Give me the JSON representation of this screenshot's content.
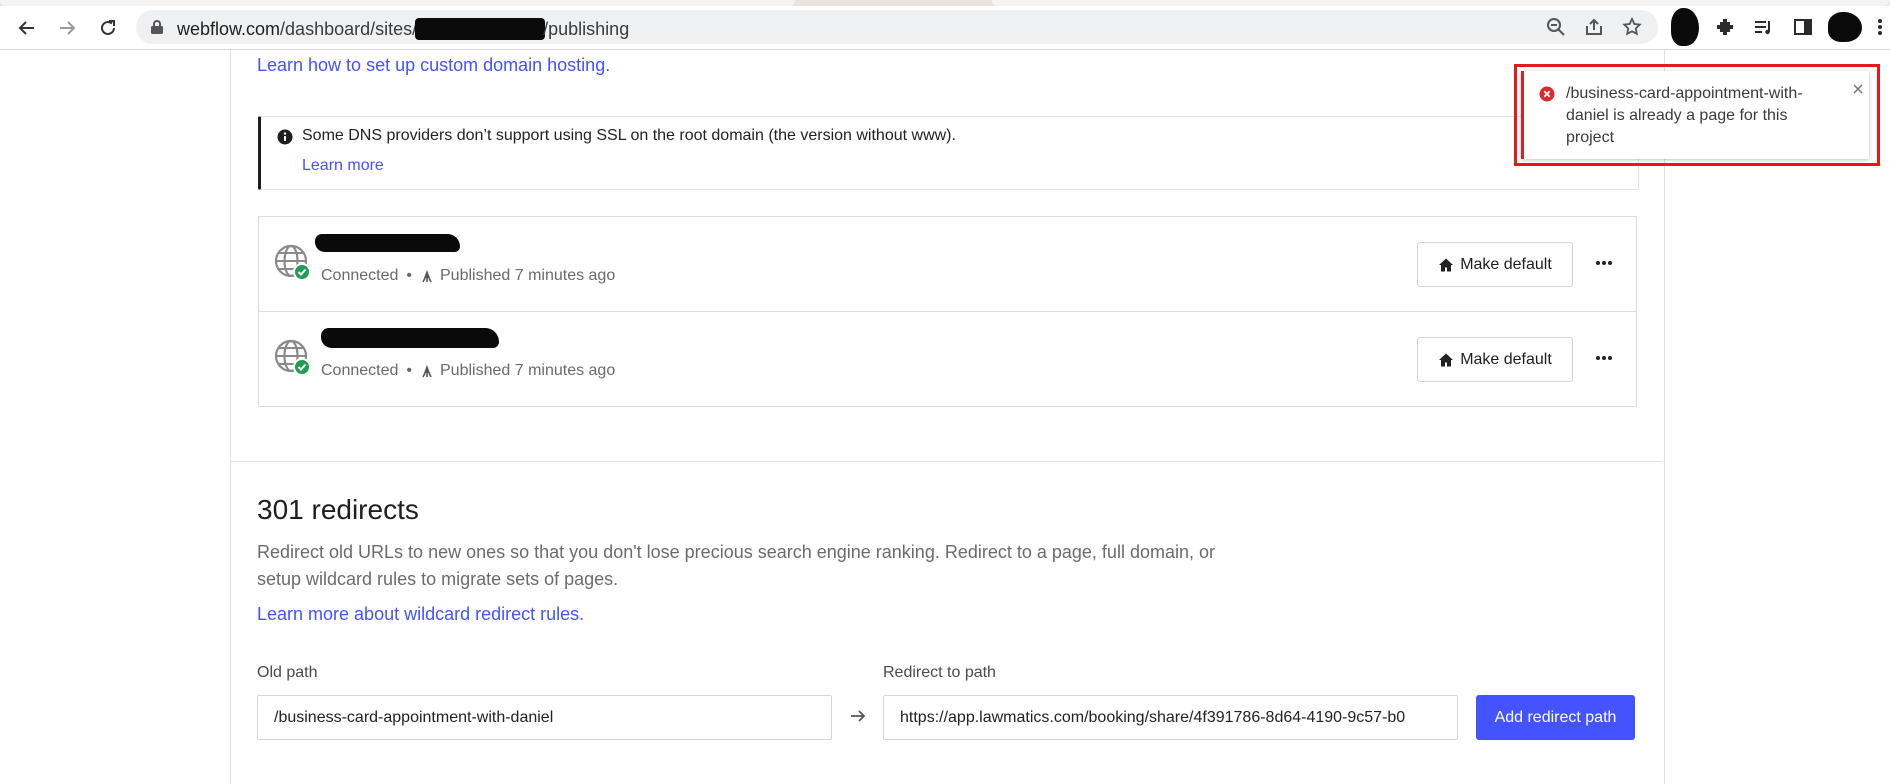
{
  "browser": {
    "url_host": "webflow.com",
    "url_path_prefix": "/dashboard/sites/",
    "url_path_suffix": "/publishing"
  },
  "setup": {
    "learn_link": "Learn how to set up custom domain hosting."
  },
  "info": {
    "text": "Some DNS providers don’t support using SSL on the root domain (the version without www).",
    "learn_more": "Learn more"
  },
  "domains": [
    {
      "status": "Connected",
      "separator": "•",
      "published": "Published 7 minutes ago",
      "action_label": "Make default"
    },
    {
      "status": "Connected",
      "separator": "•",
      "published": "Published 7 minutes ago",
      "action_label": "Make default"
    }
  ],
  "redirects": {
    "title": "301 redirects",
    "description": "Redirect old URLs to new ones so that you don't lose precious search engine ranking. Redirect to a page, full domain, or setup wildcard rules to migrate sets of pages.",
    "learn_link": "Learn more about wildcard redirect rules.",
    "old_path_label": "Old path",
    "old_path_value": "/business-card-appointment-with-daniel",
    "redirect_label": "Redirect to path",
    "redirect_value": "https://app.lawmatics.com/booking/share/4f391786-8d64-4190-9c57-b0",
    "add_button": "Add redirect path"
  },
  "toast": {
    "message": "/business-card-appointment-with-daniel is already a page for this project"
  },
  "colors": {
    "accent": "#4353ff",
    "error": "#d92c2c",
    "success": "#1f9d55"
  }
}
